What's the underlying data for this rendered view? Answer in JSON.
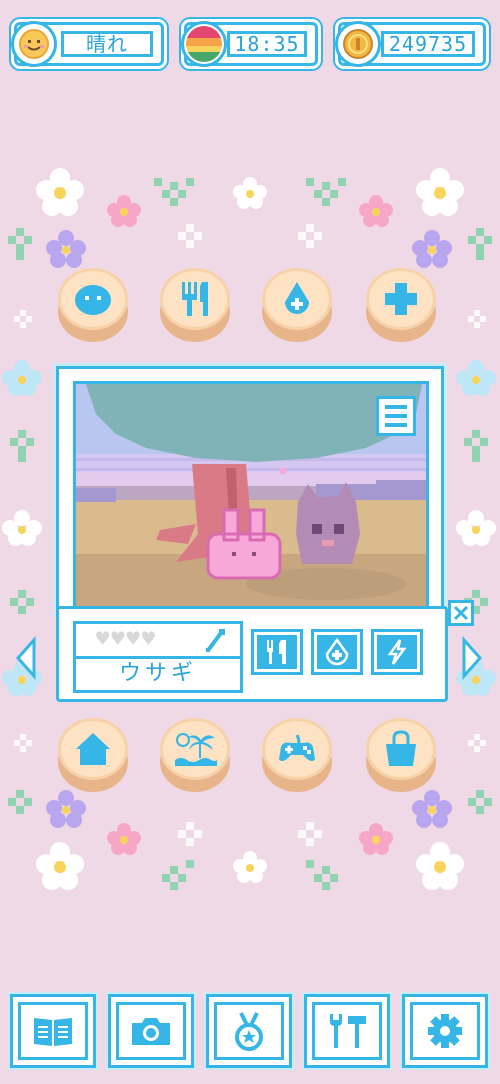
{
  "status_bar": {
    "weather": "晴れ",
    "time": "18:35",
    "coins": "249735"
  },
  "pet": {
    "name": "ウサギ",
    "hearts_filled": 0,
    "hearts_total": 4
  },
  "colors": {
    "accent": "#35b6e6",
    "background": "#f0d9e6",
    "button_cream": "#fde3c3",
    "button_shadow": "#e8b58b",
    "pet_pink": "#f7a8d8"
  },
  "icons": {
    "top_buttons": [
      "pet-face-icon",
      "fork-knife-icon",
      "water-drop-icon",
      "health-plus-icon"
    ],
    "bottom_round_buttons": [
      "home-icon",
      "island-icon",
      "gamepad-icon",
      "shopping-bag-icon"
    ],
    "stat_buttons": [
      "food-stat-icon",
      "water-stat-icon",
      "energy-stat-icon"
    ],
    "bottom_bar": [
      "book-icon",
      "camera-icon",
      "medal-icon",
      "tools-icon",
      "settings-gear-icon"
    ]
  }
}
